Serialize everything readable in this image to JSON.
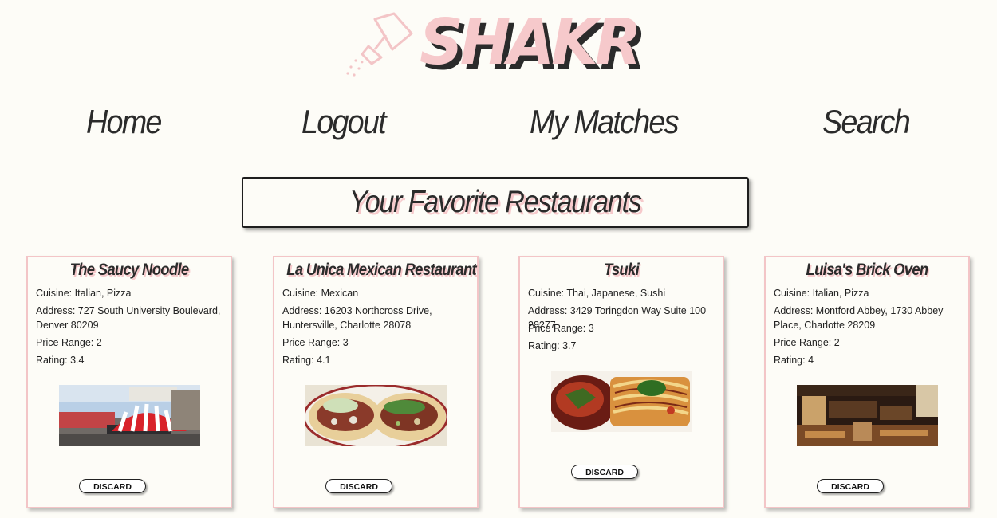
{
  "brand": {
    "name": "SHAKR"
  },
  "nav": [
    "Home",
    "Logout",
    "My Matches",
    "Search"
  ],
  "page_title": "Your Favorite Restaurants",
  "colors": {
    "accent_pink": "#f6c9cb",
    "card_border": "#f3c5c7",
    "background": "#fdfcf7",
    "text": "#2b2b2b"
  },
  "restaurants": [
    {
      "name": "The Saucy Noodle",
      "cuisine": "Cuisine: Italian, Pizza",
      "address": "Address: 727 South University Boulevard, Denver 80209",
      "price": "Price Range: 2",
      "rating": "Rating: 3.4",
      "discard": "DISCARD"
    },
    {
      "name": "La Unica Mexican Restaurant",
      "cuisine": "Cuisine: Mexican",
      "address": "Address: 16203 Northcross Drive, Huntersville, Charlotte 28078",
      "price": "Price Range: 3",
      "rating": "Rating: 4.1",
      "discard": "DISCARD"
    },
    {
      "name": "Tsuki",
      "cuisine": "Cuisine: Thai, Japanese, Sushi",
      "address": "Address: 3429 Toringdon Way Suite 100 28277",
      "price": "Price Range: 3",
      "rating": "Rating: 3.7",
      "discard": "DISCARD"
    },
    {
      "name": "Luisa's Brick Oven",
      "cuisine": "Cuisine: Italian, Pizza",
      "address": "Address: Montford Abbey, 1730 Abbey Place, Charlotte 28209",
      "price": "Price Range: 2",
      "rating": "Rating: 4",
      "discard": "DISCARD"
    }
  ]
}
